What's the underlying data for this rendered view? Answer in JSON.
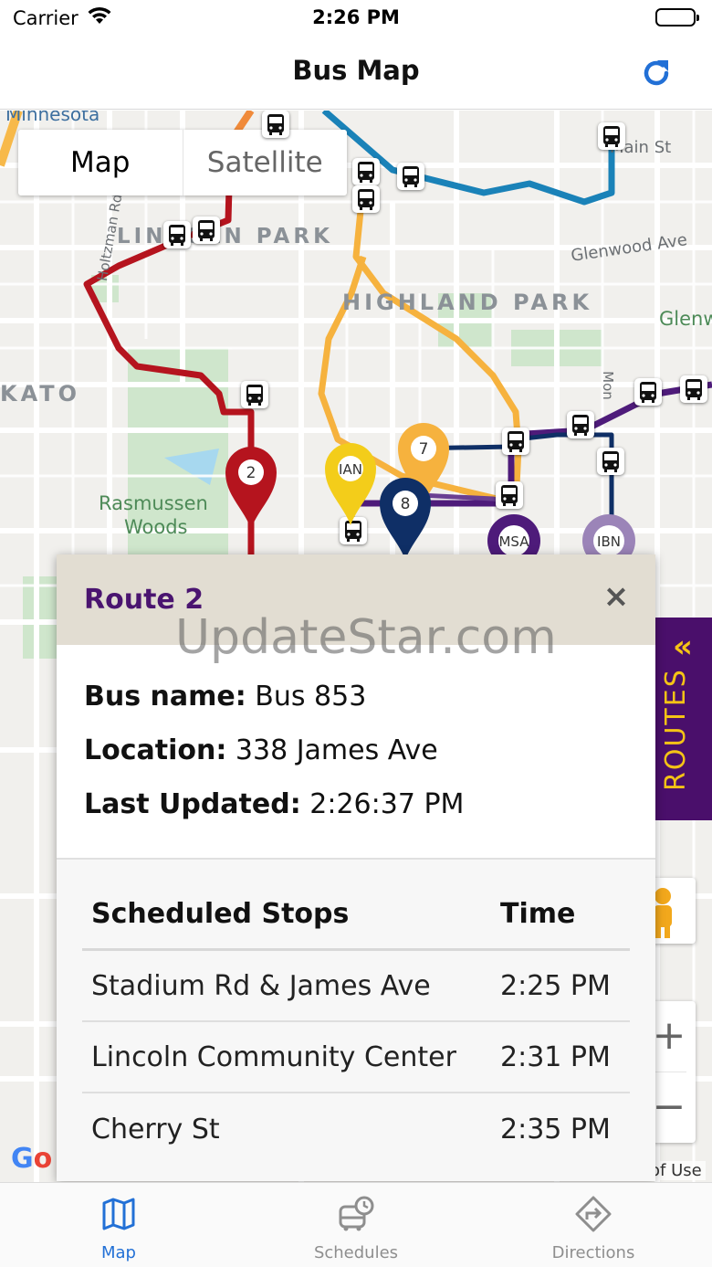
{
  "status_bar": {
    "carrier": "Carrier",
    "time": "2:26 PM"
  },
  "nav": {
    "title": "Bus Map",
    "refresh_icon": "refresh-icon"
  },
  "map": {
    "type_toggle": {
      "map_label": "Map",
      "satellite_label": "Satellite",
      "selected": "Map"
    },
    "labels": {
      "minnesota": "Minnesota",
      "lincoln_park": "LINCOLN PARK",
      "highland_park": "HIGHLAND PARK",
      "kato": "KATO",
      "rasmussen_1": "Rasmussen",
      "rasmussen_2": "Woods",
      "glenwood_ave": "Glenwood Ave",
      "glenw": "Glenw",
      "main_st": "Main St",
      "holtzman": "Holtzman Rd",
      "mon": "Mon"
    },
    "markers": {
      "route2": "2",
      "route7": "7",
      "route8": "8",
      "ian": "IAN",
      "msa": "MSA",
      "ibn": "IBN"
    },
    "routes_tab": {
      "chevron": "«",
      "label": "ROUTES"
    },
    "zoom_in": "+",
    "zoom_out": "−",
    "google": "Google",
    "terms": "of Use"
  },
  "popup": {
    "title": "Route 2",
    "close": "×",
    "bus_name_label": "Bus name:",
    "bus_name_value": "Bus 853",
    "location_label": "Location:",
    "location_value": "338 James Ave",
    "last_updated_label": "Last Updated:",
    "last_updated_value": "2:26:37 PM",
    "table": {
      "headers": {
        "stop": "Scheduled Stops",
        "time": "Time"
      },
      "rows": [
        {
          "stop": "Stadium Rd & James Ave",
          "time": "2:25 PM"
        },
        {
          "stop": "Lincoln Community Center",
          "time": "2:31 PM"
        },
        {
          "stop": "Cherry St",
          "time": "2:35 PM"
        }
      ]
    }
  },
  "watermark": "UpdateStar.com",
  "tab_bar": {
    "tabs": [
      {
        "label": "Map",
        "icon": "map-icon",
        "active": true
      },
      {
        "label": "Schedules",
        "icon": "bus-clock-icon",
        "active": false
      },
      {
        "label": "Directions",
        "icon": "directions-icon",
        "active": false
      }
    ]
  },
  "colors": {
    "route_red": "#b5141e",
    "route_orange": "#f6b23e",
    "route_blue": "#1a82b8",
    "route_purple": "#4e1b7a",
    "route_navy": "#0f2f66",
    "route_yellow": "#f3cd1a",
    "accent_blue": "#2270d6",
    "routes_tab_bg": "#4a0f6b",
    "routes_tab_fg": "#f4c316"
  }
}
